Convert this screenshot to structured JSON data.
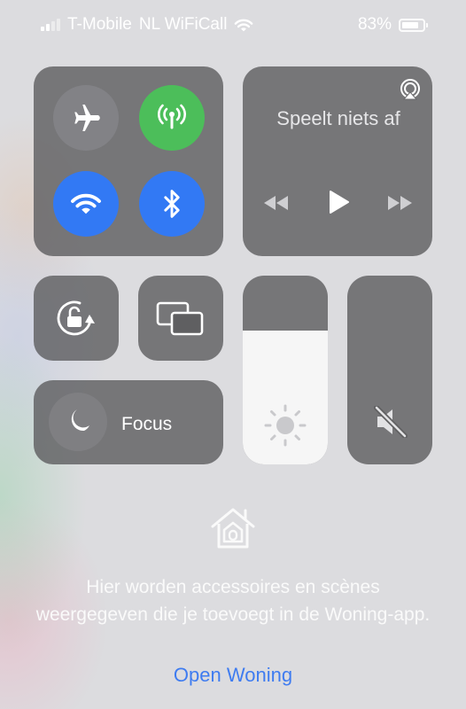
{
  "status_bar": {
    "carrier": "T-Mobile",
    "network": "NL WiFiCall",
    "battery": "83%",
    "battery_level": 0.83,
    "signal_bars": 2,
    "signal_bars_total": 4,
    "wifi_icon": "wifi-icon"
  },
  "connectivity": {
    "airplane": {
      "icon": "airplane-icon",
      "on": false
    },
    "cellular": {
      "icon": "antenna-icon",
      "on": true,
      "color": "#4cbe5a"
    },
    "wifi": {
      "icon": "wifi-icon",
      "on": true,
      "color": "#3279f4"
    },
    "bluetooth": {
      "icon": "bluetooth-icon",
      "on": true,
      "color": "#3279f4"
    }
  },
  "media": {
    "status": "Speelt niets af",
    "airplay_icon": "airplay-icon",
    "controls": [
      "rewind-icon",
      "play-icon",
      "fast-forward-icon"
    ]
  },
  "controls": {
    "orientation_lock_icon": "rotation-lock-icon",
    "screen_mirroring_icon": "screen-mirroring-icon",
    "focus": {
      "label": "Focus",
      "icon": "moon-icon"
    },
    "brightness": {
      "level": 0.71,
      "icon": "sun-icon"
    },
    "volume": {
      "level": 0,
      "icon": "speaker-muted-icon"
    }
  },
  "home": {
    "icon": "home-icon",
    "message": "Hier worden accessoires en scènes weergegeven die je toevoegt in de Woning-app.",
    "link": "Open Woning",
    "link_color": "#3f7cf0"
  }
}
